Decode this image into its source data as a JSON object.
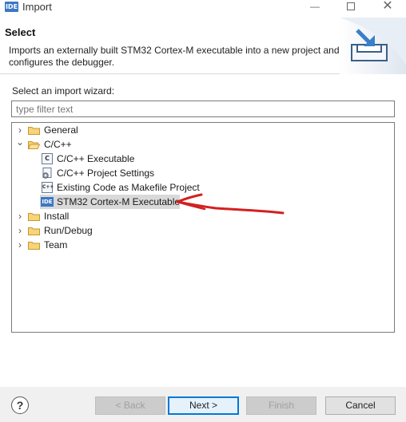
{
  "window": {
    "app_icon_text": "IDE",
    "title": "Import",
    "minimize_glyph": "—",
    "close_glyph": "✕"
  },
  "header": {
    "title": "Select",
    "description": "Imports an externally built STM32 Cortex-M executable into a new project and configures the debugger."
  },
  "wizard": {
    "label": "Select an import wizard:",
    "filter_placeholder": "type filter text",
    "filter_value": ""
  },
  "tree": {
    "items": [
      {
        "label": "General",
        "expanded": false,
        "icon": "folder-icon"
      },
      {
        "label": "C/C++",
        "expanded": true,
        "icon": "folder-icon"
      },
      {
        "label": "C/C++ Executable",
        "icon": "c-file-icon",
        "icon_text": "C"
      },
      {
        "label": "C/C++ Project Settings",
        "icon": "settings-file-icon"
      },
      {
        "label": "Existing Code as Makefile Project",
        "icon": "cpp-file-icon",
        "icon_text": "C++"
      },
      {
        "label": "STM32 Cortex-M Executable",
        "icon": "ide-icon",
        "icon_text": "IDE",
        "selected": true
      },
      {
        "label": "Install",
        "expanded": false,
        "icon": "folder-icon"
      },
      {
        "label": "Run/Debug",
        "expanded": false,
        "icon": "folder-icon"
      },
      {
        "label": "Team",
        "expanded": false,
        "icon": "folder-icon"
      }
    ],
    "collapsed_twisty": "›",
    "expanded_twisty": "⌄"
  },
  "annotation": {
    "arrow_color": "#d42020"
  },
  "footer": {
    "help_glyph": "?",
    "back_label": "< Back",
    "next_label": "Next >",
    "finish_label": "Finish",
    "cancel_label": "Cancel"
  },
  "colors": {
    "folder": "#e8b94a",
    "folder_dark": "#c8962c",
    "selection": "#d9d9d9",
    "accent": "#0078d7",
    "ide_blue": "#3b78c4"
  }
}
